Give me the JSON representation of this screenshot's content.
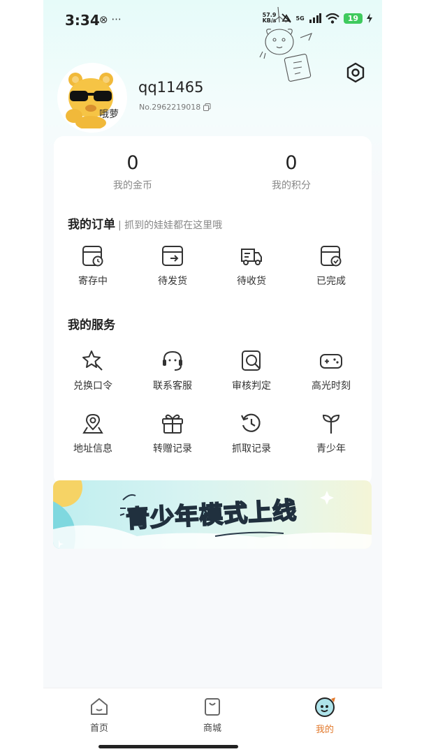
{
  "status_bar": {
    "time": "3:34",
    "left_icons": "⊗ ···",
    "net_speed_value": "57.9",
    "net_speed_unit": "KB/s",
    "network": "5G",
    "battery": "19"
  },
  "profile": {
    "username": "qq11465",
    "user_no": "No.2962219018",
    "avatar_tag": "哦萝"
  },
  "stats": {
    "coins_value": "0",
    "coins_label": "我的金币",
    "points_value": "0",
    "points_label": "我的积分"
  },
  "orders": {
    "title": "我的订单",
    "subtitle": "| 抓到的娃娃都在这里哦",
    "items": [
      {
        "label": "寄存中",
        "icon": "storage-clock-icon"
      },
      {
        "label": "待发货",
        "icon": "box-out-icon"
      },
      {
        "label": "待收货",
        "icon": "truck-icon"
      },
      {
        "label": "已完成",
        "icon": "box-check-icon"
      }
    ]
  },
  "services": {
    "title": "我的服务",
    "items": [
      {
        "label": "兑换口令",
        "icon": "star-cursor-icon"
      },
      {
        "label": "联系客服",
        "icon": "headset-icon"
      },
      {
        "label": "审核判定",
        "icon": "search-review-icon"
      },
      {
        "label": "高光时刻",
        "icon": "gamepad-icon"
      },
      {
        "label": "地址信息",
        "icon": "location-icon"
      },
      {
        "label": "转赠记录",
        "icon": "gift-icon"
      },
      {
        "label": "抓取记录",
        "icon": "history-icon"
      },
      {
        "label": "青少年",
        "icon": "sprout-icon"
      }
    ]
  },
  "banner": {
    "text": "青少年模式上线"
  },
  "bottom_nav": {
    "items": [
      {
        "label": "首页",
        "icon": "home-icon"
      },
      {
        "label": "商城",
        "icon": "shopping-bag-icon"
      },
      {
        "label": "我的",
        "icon": "profile-face-icon"
      }
    ],
    "active_color": "#e2782a"
  }
}
